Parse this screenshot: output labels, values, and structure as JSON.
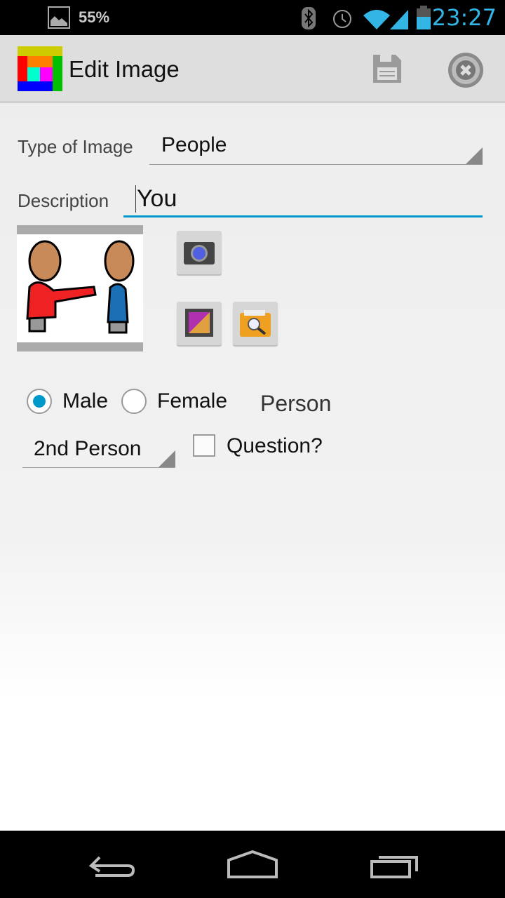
{
  "status_bar": {
    "battery_percent": "55%",
    "time": "23:27",
    "icons": [
      "image-notification-icon",
      "bluetooth-icon",
      "alarm-icon",
      "wifi-icon",
      "signal-icon",
      "battery-icon"
    ],
    "time_color": "#33b5e5"
  },
  "action_bar": {
    "title": "Edit Image",
    "icons": [
      "app-logo",
      "save-icon",
      "close-icon"
    ]
  },
  "form": {
    "type_label": "Type of Image",
    "type_value": "People",
    "description_label": "Description",
    "description_value": "You",
    "image_buttons": [
      "camera-icon",
      "gallery-icon",
      "folder-search-icon"
    ],
    "gender": {
      "male_label": "Male",
      "female_label": "Female",
      "selected": "Male"
    },
    "person_label": "Person",
    "person_value": "2nd Person",
    "question_label": "Question?",
    "question_checked": false
  },
  "accent_color": "#0099cc",
  "nav_bar": {
    "icons": [
      "back-icon",
      "home-icon",
      "recents-icon"
    ]
  }
}
